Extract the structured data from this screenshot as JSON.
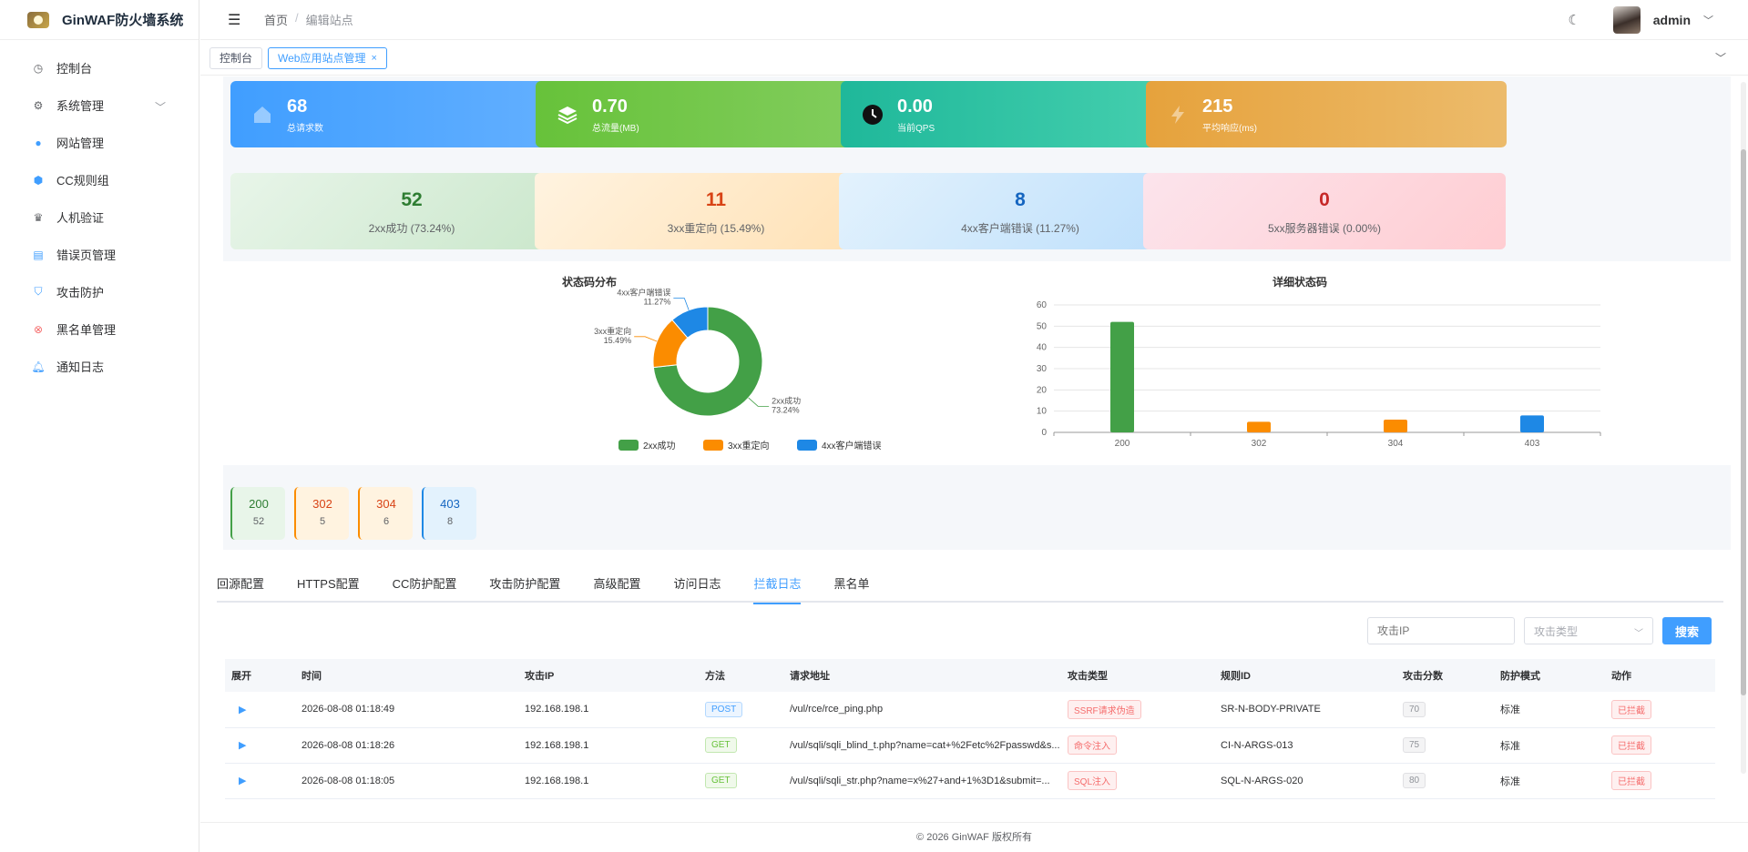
{
  "app": {
    "title": "GinWAF防火墙系统"
  },
  "sidebar": {
    "items": [
      {
        "label": "控制台",
        "icon": "dashboard-icon"
      },
      {
        "label": "系统管理",
        "icon": "settings-icon"
      },
      {
        "label": "网站管理",
        "icon": "globe-icon"
      },
      {
        "label": "CC规则组",
        "icon": "shield-icon"
      },
      {
        "label": "人机验证",
        "icon": "robot-icon"
      },
      {
        "label": "错误页管理",
        "icon": "page-icon"
      },
      {
        "label": "攻击防护",
        "icon": "shield-check-icon"
      },
      {
        "label": "黑名单管理",
        "icon": "block-icon"
      },
      {
        "label": "通知日志",
        "icon": "bell-icon"
      }
    ]
  },
  "header": {
    "breadcrumb": [
      "首页",
      "编辑站点"
    ],
    "user": "admin"
  },
  "tags": [
    {
      "label": "控制台"
    },
    {
      "label": "Web应用站点管理"
    }
  ],
  "stats": [
    {
      "value": "68",
      "label": "总请求数",
      "color": "#409eff"
    },
    {
      "value": "0.70",
      "label": "总流量(MB)",
      "color": "#67c23a"
    },
    {
      "value": "0.00",
      "label": "当前QPS",
      "color": "#20b2aa"
    },
    {
      "value": "215",
      "label": "平均响应(ms)",
      "color": "#e6a23c"
    }
  ],
  "status_cards": [
    {
      "value": "52",
      "label": "2xx成功 (73.24%)",
      "color": "#2e7d32"
    },
    {
      "value": "11",
      "label": "3xx重定向 (15.49%)",
      "color": "#d84315"
    },
    {
      "value": "8",
      "label": "4xx客户端错误 (11.27%)",
      "color": "#1565c0"
    },
    {
      "value": "0",
      "label": "5xx服务器错误 (0.00%)",
      "color": "#c62828"
    }
  ],
  "chart_data": [
    {
      "type": "pie",
      "title": "状态码分布",
      "categories": [
        "2xx成功",
        "3xx重定向",
        "4xx客户端错误"
      ],
      "values": [
        73.24,
        15.49,
        11.27
      ],
      "colors": [
        "#43a047",
        "#fb8c00",
        "#1e88e5"
      ],
      "labels": [
        "2xx成功\n73.24%",
        "3xx重定向\n15.49%",
        "4xx客户端错误\n11.27%"
      ],
      "legend": [
        "2xx成功",
        "3xx重定向",
        "4xx客户端错误"
      ],
      "legend_position": "bottom"
    },
    {
      "type": "bar",
      "title": "详细状态码",
      "categories": [
        "200",
        "302",
        "304",
        "403"
      ],
      "values": [
        52,
        5,
        6,
        8
      ],
      "colors": [
        "#43a047",
        "#fb8c00",
        "#fb8c00",
        "#1e88e5"
      ],
      "ylim": [
        0,
        60
      ],
      "yticks": [
        0,
        10,
        20,
        30,
        40,
        50,
        60
      ],
      "grid": true
    }
  ],
  "mini_codes": [
    {
      "code": "200",
      "count": "52",
      "color": "#2e7d32",
      "bg": "#e8f5e9",
      "border": "#43a047"
    },
    {
      "code": "302",
      "count": "5",
      "color": "#d84315",
      "bg": "#fff3e0",
      "border": "#fb8c00"
    },
    {
      "code": "304",
      "count": "6",
      "color": "#d84315",
      "bg": "#fff3e0",
      "border": "#fb8c00"
    },
    {
      "code": "403",
      "count": "8",
      "color": "#1565c0",
      "bg": "#e3f2fd",
      "border": "#1e88e5"
    }
  ],
  "config_tabs": [
    "回源配置",
    "HTTPS配置",
    "CC防护配置",
    "攻击防护配置",
    "高级配置",
    "访问日志",
    "拦截日志",
    "黑名单"
  ],
  "active_tab": 6,
  "filters": {
    "ip_placeholder": "攻击IP",
    "type_placeholder": "攻击类型",
    "search_label": "搜索"
  },
  "table": {
    "columns": [
      "展开",
      "时间",
      "攻击IP",
      "方法",
      "请求地址",
      "攻击类型",
      "规则ID",
      "攻击分数",
      "防护模式",
      "动作"
    ],
    "rows": [
      [
        "▶",
        "2026-08-08 01:18:49",
        "192.168.198.1",
        "POST",
        "/vul/rce/rce_ping.php",
        "SSRF请求伪造",
        "SR-N-BODY-PRIVATE",
        "70",
        "标准",
        "已拦截"
      ],
      [
        "▶",
        "2026-08-08 01:18:26",
        "192.168.198.1",
        "GET",
        "/vul/sqli/sqli_blind_t.php?name=cat+%2Fetc%2Fpasswd&s...",
        "命令注入",
        "CI-N-ARGS-013",
        "75",
        "标准",
        "已拦截"
      ],
      [
        "▶",
        "2026-08-08 01:18:05",
        "192.168.198.1",
        "GET",
        "/vul/sqli/sqli_str.php?name=x%27+and+1%3D1&submit=...",
        "SQL注入",
        "SQL-N-ARGS-020",
        "80",
        "标准",
        "已拦截"
      ]
    ]
  },
  "footer": {
    "text": "© 2026 GinWAF 版权所有"
  }
}
